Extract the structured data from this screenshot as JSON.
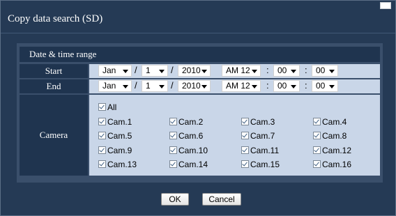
{
  "window": {
    "title": "Copy data search (SD)"
  },
  "section": {
    "title": "Date & time range"
  },
  "start": {
    "label": "Start",
    "month": "Jan",
    "day": "1",
    "year": "2010",
    "hour": "AM 12",
    "minute": "00",
    "second": "00"
  },
  "end": {
    "label": "End",
    "month": "Jan",
    "day": "1",
    "year": "2010",
    "hour": "AM 12",
    "minute": "00",
    "second": "00"
  },
  "separators": {
    "date": "/",
    "time": ":"
  },
  "camera": {
    "label": "Camera",
    "all_label": "All",
    "all_checked": true,
    "cams": [
      {
        "label": "Cam.1",
        "checked": true
      },
      {
        "label": "Cam.2",
        "checked": true
      },
      {
        "label": "Cam.3",
        "checked": true
      },
      {
        "label": "Cam.4",
        "checked": true
      },
      {
        "label": "Cam.5",
        "checked": true
      },
      {
        "label": "Cam.6",
        "checked": true
      },
      {
        "label": "Cam.7",
        "checked": true
      },
      {
        "label": "Cam.8",
        "checked": true
      },
      {
        "label": "Cam.9",
        "checked": true
      },
      {
        "label": "Cam.10",
        "checked": true
      },
      {
        "label": "Cam.11",
        "checked": true
      },
      {
        "label": "Cam.12",
        "checked": true
      },
      {
        "label": "Cam.13",
        "checked": true
      },
      {
        "label": "Cam.14",
        "checked": true
      },
      {
        "label": "Cam.15",
        "checked": true
      },
      {
        "label": "Cam.16",
        "checked": true
      }
    ]
  },
  "buttons": {
    "ok": "OK",
    "cancel": "Cancel"
  },
  "colors": {
    "dialog_bg": "#253a55",
    "panel_bg": "#3a4f6b",
    "header_bg": "#1f344f",
    "value_bg": "#c9d6e8"
  }
}
